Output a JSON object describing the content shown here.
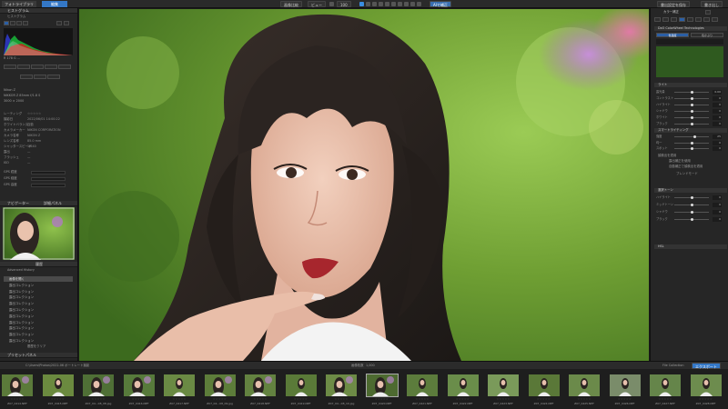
{
  "topbar": {
    "tab_library": "フォトライブラリ",
    "tab_edit": "編集",
    "btn_compare": "画像比較",
    "btn_view": "ビュー",
    "zoom": "100",
    "btn_ai": "AIで補正",
    "btn_export_jpeg": "書出設定を保存",
    "btn_export": "書き出し"
  },
  "left_panel": {
    "histogram_title": "ヒストグラム",
    "histogram_label": "ヒストグラム",
    "hist_info": "R  178  G  ...",
    "lens_rows": [
      {
        "label": "Nikon Z",
        "value": ""
      },
      {
        "label": "NIKKOR Z 85mm f/1.8 S",
        "value": ""
      },
      {
        "label": "3000 × 2000",
        "value": ""
      }
    ],
    "metadata_rows": [
      {
        "label": "レーティング",
        "value": "☆☆☆☆☆"
      },
      {
        "label": "撮影日",
        "value": "2022/06/01 14:00:22"
      },
      {
        "label": "ホワイトバランス",
        "value": "自動"
      },
      {
        "label": "カメラメーカー",
        "value": "NIKON CORPORATION"
      },
      {
        "label": "カメラ名称",
        "value": "NIKON Z"
      },
      {
        "label": "レンズ名称",
        "value": "85.0 mm"
      },
      {
        "label": "シャッタースピード",
        "value": "1/640"
      },
      {
        "label": "露出",
        "value": "—"
      },
      {
        "label": "フラッシュ",
        "value": "—"
      },
      {
        "label": "ISO",
        "value": "—"
      }
    ],
    "gps_rows": [
      {
        "label": "GPS 緯度",
        "value": ""
      },
      {
        "label": "GPS 経度",
        "value": ""
      },
      {
        "label": "GPS 高度",
        "value": ""
      }
    ],
    "nav_title": "ナビゲーター",
    "nav_tab2": "詳細パネル",
    "history_title": "履歴",
    "history_sub": "Advanced History",
    "history_items": [
      "画像を開く",
      "露出コレクション",
      "露出コレクション",
      "露出コレクション",
      "露出コレクション",
      "露出コレクション",
      "露出コレクション",
      "露出コレクション",
      "露出コレクション",
      "露出コレクション",
      "露出コレクション"
    ],
    "history_footer": "履歴をクリア",
    "presets_title": "プリセットパネル"
  },
  "right_panel": {
    "title": "カラー補正",
    "section_wb": "DxO ColorWheel Technologies",
    "wb_btn1": "色温度",
    "wb_btn2": "色かぶり",
    "sec_light": "ライト",
    "sliders": [
      {
        "label": "露光量",
        "value": "0.00",
        "pos": 0.5
      },
      {
        "label": "コントラスト",
        "value": "0",
        "pos": 0.5
      },
      {
        "label": "ハイライト",
        "value": "0",
        "pos": 0.5
      },
      {
        "label": "シャドウ",
        "value": "0",
        "pos": 0.5
      },
      {
        "label": "ホワイト",
        "value": "0",
        "pos": 0.5
      },
      {
        "label": "ブラック",
        "value": "0",
        "pos": 0.5
      }
    ],
    "sec_smart": "スマートライティング",
    "sliders2": [
      {
        "label": "強度",
        "value": "25",
        "pos": 0.6
      },
      {
        "label": "均一",
        "value": "0",
        "pos": 0.5
      },
      {
        "label": "スポット",
        "value": "0",
        "pos": 0.5
      }
    ],
    "opt_1": "顔検出を適用",
    "opt_2": "露出補正を使用",
    "opt_3": "自動補正で顔検出を適用",
    "opt_4": "ブレンドモード",
    "sec_selective": "選択トーン",
    "sliders3": [
      {
        "label": "ハイライト",
        "value": "0",
        "pos": 0.5
      },
      {
        "label": "ミッドトーン",
        "value": "0",
        "pos": 0.5
      },
      {
        "label": "シャドウ",
        "value": "0",
        "pos": 0.5
      },
      {
        "label": "ブラック",
        "value": "0",
        "pos": 0.5
      }
    ],
    "sec_hsl": "HSL"
  },
  "film_header": {
    "path": "C:\\Users\\Photos\\2022-06 ポートレート撮影",
    "count_label": "画像枚数",
    "count_value": "1,000",
    "btn_collection": "File Collection",
    "btn_export": "エクスポート"
  },
  "filmstrip": [
    {
      "name": "Z07_0414.NEF",
      "c": "#5b7a3a"
    },
    {
      "name": "Z07_0415.NEF",
      "c": "#6b8a3f"
    },
    {
      "name": "Z07_04...08_08.jpg",
      "c": "#4f6f36"
    },
    {
      "name": "Z07_0416.NEF",
      "c": "#577a3b"
    },
    {
      "name": "Z07_0417.NEF",
      "c": "#6a8a44"
    },
    {
      "name": "Z07_04...08_09.jpg",
      "c": "#5d7d3a"
    },
    {
      "name": "Z07_0418.NEF",
      "c": "#638240"
    },
    {
      "name": "Z07_0419.NEF",
      "c": "#5a7a38"
    },
    {
      "name": "Z07_04...08_10.jpg",
      "c": "#6d8b46"
    },
    {
      "name": "Z07_0420.NEF",
      "c": "#4d6a30"
    },
    {
      "name": "Z07_0421.NEF",
      "c": "#5c7c3c"
    },
    {
      "name": "Z07_0422.NEF",
      "c": "#6a8d4a"
    },
    {
      "name": "Z07_0423.NEF",
      "c": "#7a9a5a"
    },
    {
      "name": "Z07_0424.NEF",
      "c": "#5a7838"
    },
    {
      "name": "Z07_0425.NEF",
      "c": "#6b8a4a"
    },
    {
      "name": "Z07_0426.NEF",
      "c": "#7a8c6a"
    },
    {
      "name": "Z07_0427.NEF",
      "c": "#65854a"
    },
    {
      "name": "Z07_0428.NEF",
      "c": "#6d8c4e"
    }
  ]
}
